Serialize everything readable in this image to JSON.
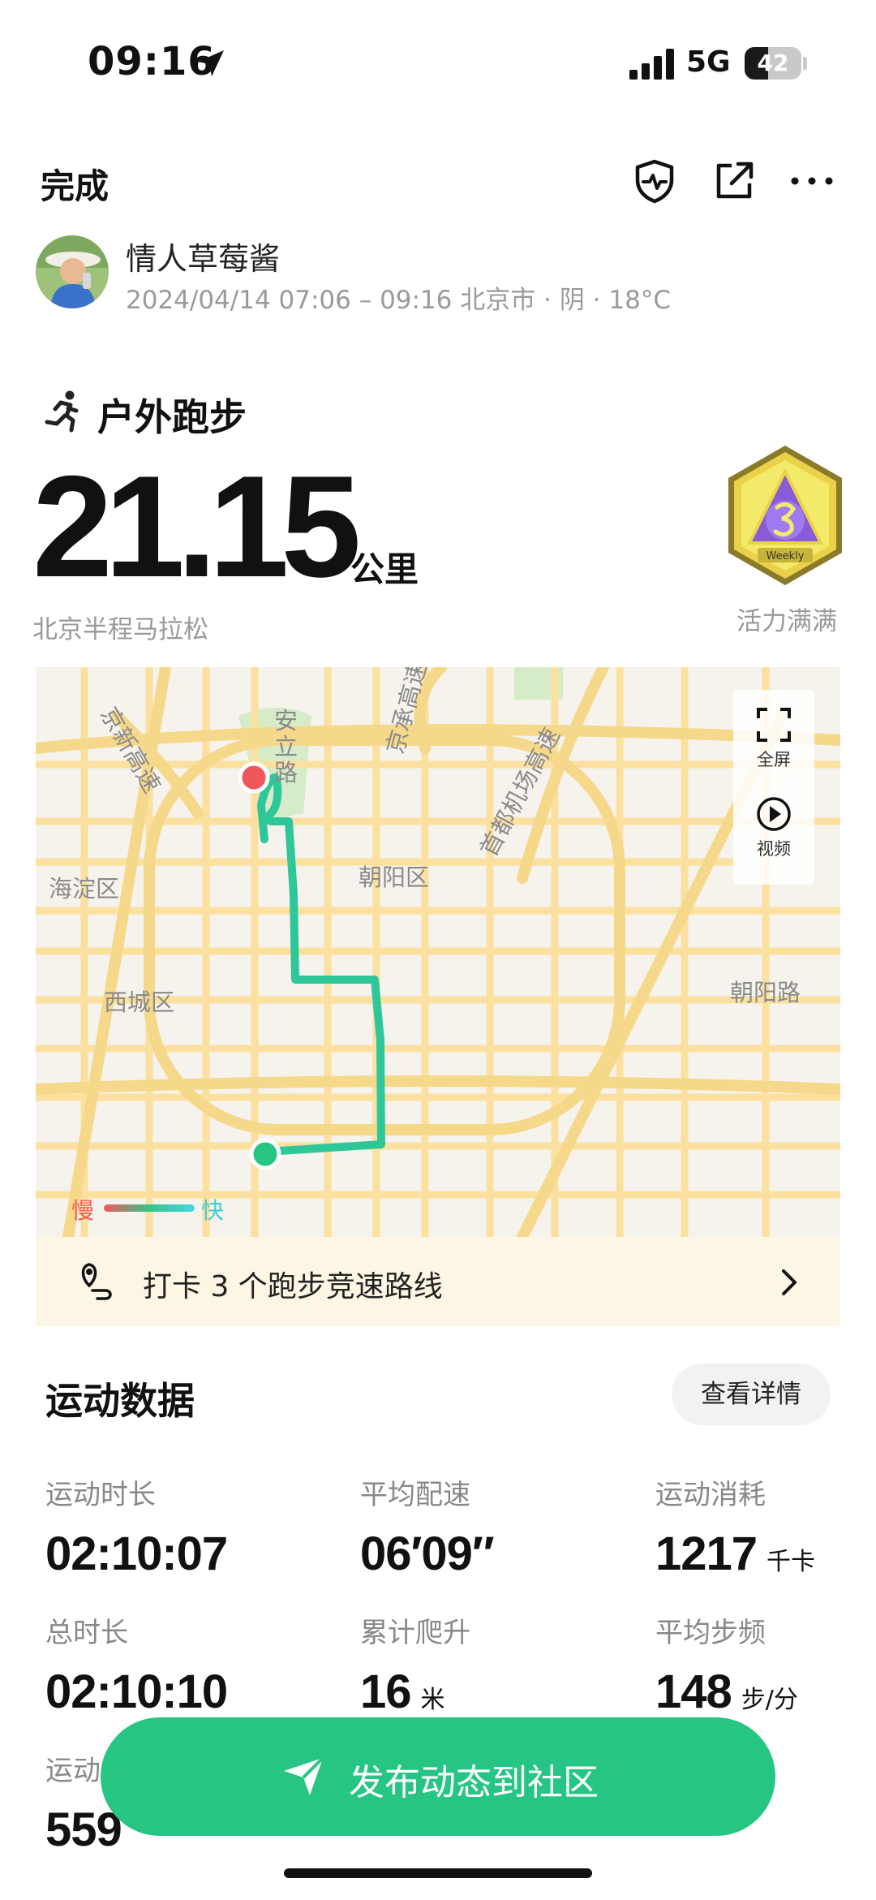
{
  "status_bar": {
    "time": "09:16",
    "network": "5G",
    "battery": "42",
    "battery_level": 0.42
  },
  "header": {
    "done_label": "完成"
  },
  "user": {
    "name": "情人草莓酱",
    "meta": "2024/04/14 07:06 – 09:16 北京市 · 阴 · 18°C"
  },
  "activity": {
    "type": "户外跑步",
    "distance": "21.15",
    "distance_unit": "公里",
    "event": "北京半程马拉松",
    "badge_text": "Weekly",
    "badge_label": "活力满满"
  },
  "map": {
    "labels": [
      "京新高速",
      "安立路",
      "京承高速",
      "首都机场高速",
      "海淀区",
      "朝阳区",
      "西城区",
      "朝阳路"
    ],
    "controls": {
      "fullscreen": "全屏",
      "video": "视频"
    },
    "legend": {
      "slow": "慢",
      "fast": "快"
    },
    "colors": {
      "route": "#2ec79a",
      "start": "#27c583",
      "end": "#f0575c",
      "road": "#fbe0a0"
    }
  },
  "checkin": {
    "text": "打卡 3 个跑步竞速路线"
  },
  "stats": {
    "title": "运动数据",
    "details_button": "查看详情",
    "items": [
      {
        "label": "运动时长",
        "value": "02:10:07",
        "unit": ""
      },
      {
        "label": "平均配速",
        "value": "06′09″",
        "unit": ""
      },
      {
        "label": "运动消耗",
        "value": "1217",
        "unit": "千卡"
      },
      {
        "label": "总时长",
        "value": "02:10:10",
        "unit": ""
      },
      {
        "label": "累计爬升",
        "value": "16",
        "unit": "米"
      },
      {
        "label": "平均步频",
        "value": "148",
        "unit": "步/分"
      },
      {
        "label": "运动",
        "value": "559",
        "unit": ""
      }
    ]
  },
  "publish": {
    "label": "发布动态到社区"
  }
}
